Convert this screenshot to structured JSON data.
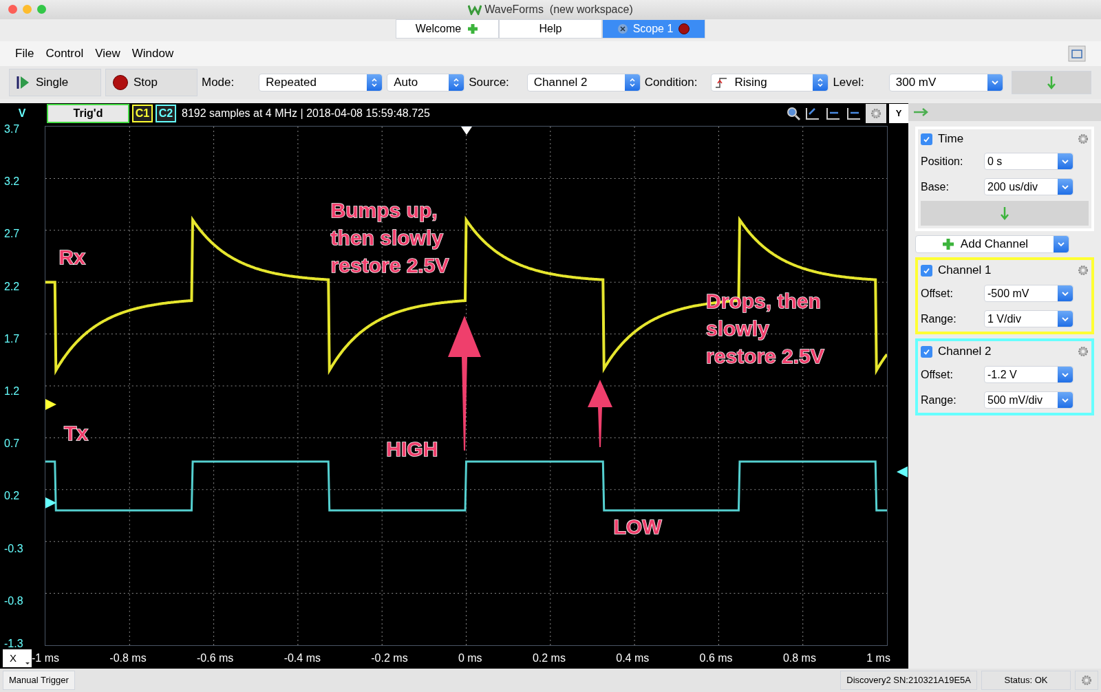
{
  "window": {
    "title": "WaveForms",
    "subtitle": "(new workspace)"
  },
  "tabs": [
    {
      "label": "Welcome",
      "selected": false,
      "kind": "add"
    },
    {
      "label": "Help",
      "selected": false,
      "kind": "plain"
    },
    {
      "label": "Scope 1",
      "selected": true,
      "kind": "close"
    }
  ],
  "menu": [
    "File",
    "Control",
    "View",
    "Window"
  ],
  "toolbar": {
    "buttons": [
      {
        "label": "Single",
        "kind": "single"
      },
      {
        "label": "Stop",
        "kind": "stop"
      }
    ],
    "controls": [
      {
        "label": "Mode:",
        "value": "Repeated",
        "kind": "popup"
      },
      {
        "value": "Auto",
        "kind": "popup"
      },
      {
        "label": "Source:",
        "value": "Channel 2",
        "kind": "popup"
      },
      {
        "label": "Condition:",
        "value": "Rising",
        "kind": "edge"
      },
      {
        "label": "Level:",
        "value": "300 mV",
        "kind": "combo"
      }
    ]
  },
  "scope": {
    "axis_label": "V",
    "trigger_status": "Trig'd",
    "channel_badges": [
      {
        "label": "C1",
        "color": "#ffff33"
      },
      {
        "label": "C2",
        "color": "#66ffff"
      }
    ],
    "info": "8192 samples at 4 MHz | 2018-04-08 15:59:48.725",
    "y_labels": [
      "3.7",
      "3.2",
      "2.7",
      "2.2",
      "1.7",
      "1.2",
      "0.7",
      "0.2",
      "-0.3",
      "-0.8",
      "-1.3"
    ],
    "x_axis_button": "X",
    "x_labels": [
      "-1 ms",
      "-0.8 ms",
      "-0.6 ms",
      "-0.4 ms",
      "-0.2 ms",
      "0 ms",
      "0.2 ms",
      "0.4 ms",
      "0.6 ms",
      "0.8 ms",
      "1 ms"
    ],
    "annotations": [
      "Rx",
      "Tx",
      "Bumps up,\nthen slowly\nrestore 2.5V",
      "HIGH",
      "LOW",
      "Drops, then\nslowly\nrestore 2.5V"
    ]
  },
  "panel": {
    "y_button": "Y",
    "time": {
      "title": "Time",
      "checked": true,
      "fields": [
        {
          "label": "Position:",
          "value": "0 s"
        },
        {
          "label": "Base:",
          "value": "200 us/div"
        }
      ]
    },
    "add_channel": "Add Channel",
    "channels": [
      {
        "name": "Channel 1",
        "checked": true,
        "color": "#ffff33",
        "fields": [
          {
            "label": "Offset:",
            "value": "-500 mV"
          },
          {
            "label": "Range:",
            "value": "1 V/div"
          }
        ]
      },
      {
        "name": "Channel 2",
        "checked": true,
        "color": "#66ffff",
        "fields": [
          {
            "label": "Offset:",
            "value": "-1.2 V"
          },
          {
            "label": "Range:",
            "value": "500 mV/div"
          }
        ]
      }
    ]
  },
  "status_bar": {
    "manual_trigger": "Manual Trigger",
    "device": "Discovery2 SN:210321A19E5A",
    "status": "Status: OK"
  }
}
